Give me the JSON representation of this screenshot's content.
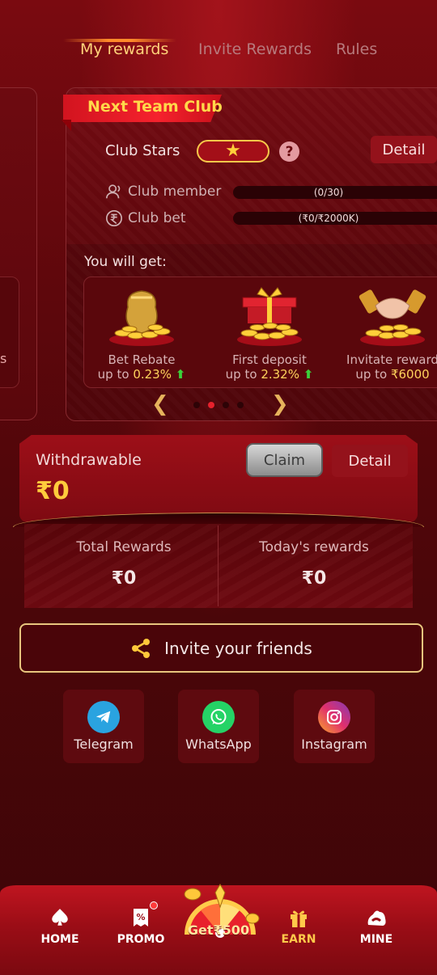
{
  "tabs": [
    {
      "label": "My rewards",
      "active": true
    },
    {
      "label": "Invite Rewards",
      "active": false
    },
    {
      "label": "Rules",
      "active": false
    }
  ],
  "left_card": {
    "partial_text": "s"
  },
  "club": {
    "title": "Next Team Club",
    "stars_label": "Club Stars",
    "stars_count": 1,
    "help_symbol": "?",
    "detail_label": "Detail",
    "member_label": "Club member",
    "member_progress": "(0/30)",
    "bet_label": "Club bet",
    "bet_progress": "(₹0/₹2000K)",
    "you_will_get": "You will get:",
    "rewards": [
      {
        "title": "Bet Rebate",
        "prefix": "up to",
        "value": "0.23%",
        "trend": "up",
        "icon": "coin-bag-icon"
      },
      {
        "title": "First deposit",
        "prefix": "up to",
        "value": "2.32%",
        "trend": "up",
        "icon": "gift-coins-icon"
      },
      {
        "title": "Invitate reward",
        "prefix": "up to",
        "value": "₹6000",
        "trend": "none",
        "icon": "handshake-coins-icon"
      }
    ],
    "pager": {
      "pages": 4,
      "active_index": 1
    }
  },
  "withdrawable": {
    "label": "Withdrawable",
    "amount": "₹0",
    "claim_label": "Claim",
    "detail_label": "Detail"
  },
  "totals": {
    "total_label": "Total Rewards",
    "total_value": "₹0",
    "today_label": "Today's rewards",
    "today_value": "₹0"
  },
  "invite": {
    "label": "Invite your friends",
    "icon": "share-icon"
  },
  "socials": [
    {
      "label": "Telegram",
      "icon": "telegram-icon",
      "color": "#2aa3e0"
    },
    {
      "label": "WhatsApp",
      "icon": "whatsapp-icon",
      "color": "#25d366"
    },
    {
      "label": "Instagram",
      "icon": "instagram-icon",
      "color": "#d62976"
    }
  ],
  "nav": {
    "home": "HOME",
    "promo": "PROMO",
    "center": "Get₹500",
    "earn": "EARN",
    "mine": "MINE",
    "active": "earn"
  },
  "colors": {
    "accent_gold": "#ffd37a",
    "amount_gold": "#ffcb3c",
    "brand_red": "#bf1520",
    "background": "#4a0508"
  }
}
